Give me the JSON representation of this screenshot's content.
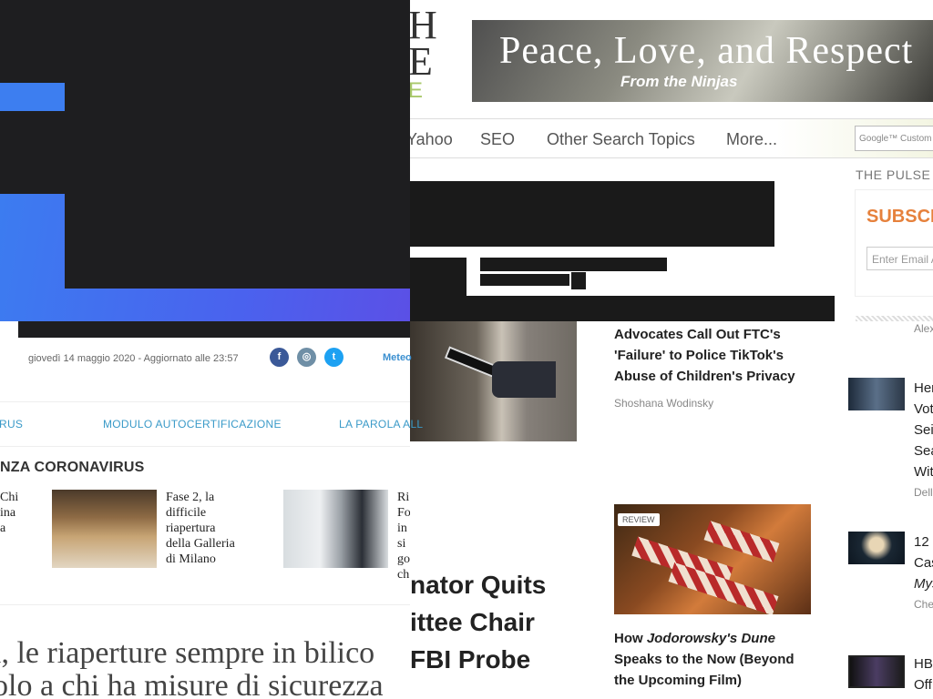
{
  "background_page": {
    "logo_letters": [
      "H",
      "E"
    ],
    "logo_letter_green": "E",
    "banner": {
      "title": "Peace, Love, and Respect",
      "subtitle": "From the Ninjas"
    },
    "nav": {
      "items": [
        "Yahoo",
        "SEO",
        "Other Search Topics",
        "More..."
      ]
    },
    "search": {
      "placeholder": "Google™ Custom"
    },
    "sidebar": {
      "pulse_label": "THE PULSE",
      "subscribe_title": "SUBSCRIBE",
      "email_placeholder": "Enter Email Address",
      "author_top": "Alex",
      "items": [
        {
          "lines": [
            "Her",
            "Vot",
            "Sei",
            "Sea",
            "Wit"
          ],
          "byline": "Dell"
        },
        {
          "lines": [
            "12 c",
            "Cas",
            "Mys"
          ],
          "byline": "Che"
        },
        {
          "lines": [
            "HBC",
            "Off"
          ],
          "byline": ""
        }
      ]
    },
    "story1": {
      "title": "Advocates Call Out FTC's 'Failure' to Police TikTok's Abuse of Children's Privacy",
      "author": "Shoshana Wodinsky"
    },
    "story2": {
      "badge": "REVIEW",
      "title_pre": "How ",
      "title_em": "Jodorowsky's Dune",
      "title_post": " Speaks to the Now (Beyond the Upcoming Film)"
    },
    "big_headline": {
      "lines": [
        "nator Quits",
        "ittee Chair",
        "FBI Probe"
      ]
    }
  },
  "foreground_page": {
    "date_line": "giovedì 14 maggio 2020 - Aggiornato alle  23:57",
    "social": [
      {
        "name": "facebook",
        "glyph": "f",
        "color": "#3b5998"
      },
      {
        "name": "instagram",
        "glyph": "◎",
        "color": "#6f8fa6"
      },
      {
        "name": "twitter",
        "glyph": "t",
        "color": "#1da1f2"
      }
    ],
    "meteo": "Meteo",
    "nav": [
      "RUS",
      "MODULO AUTOCERTIFICAZIONE",
      "LA PAROLA ALL"
    ],
    "section_title": "NZA CORONAVIRUS",
    "cards": [
      {
        "text": "Chi\nina\na"
      },
      {
        "text": "Fase 2, la\ndifficile\nriapertura\ndella Galleria\ndi Milano"
      },
      {
        "text": "Ri\nFo\nin\nsi\ngo\nch"
      }
    ],
    "main_headline": [
      "i, le riaperture sempre in bilico",
      "olo a chi ha misure di sicurezza"
    ]
  },
  "colors": {
    "accent_blue": "#3d7ef0",
    "dark_overlay": "#1e1e20",
    "link_blue": "#3a9ac8",
    "orange": "#e6813c",
    "logo_green": "#a8c86a"
  }
}
